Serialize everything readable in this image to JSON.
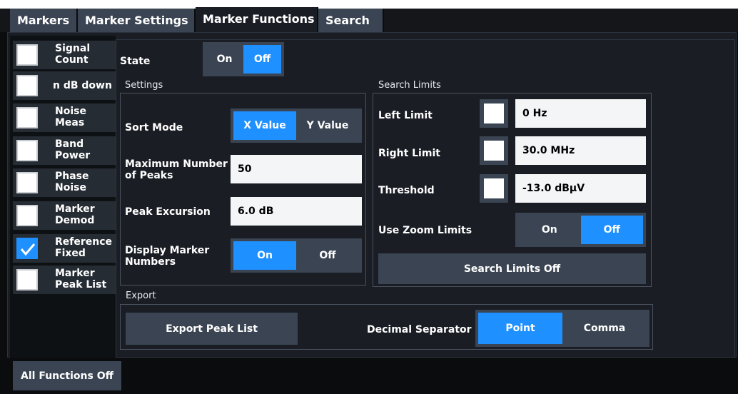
{
  "tabs": [
    {
      "label": "Markers",
      "active": false
    },
    {
      "label": "Marker Settings",
      "active": false
    },
    {
      "label": "Marker Functions",
      "active": true
    },
    {
      "label": "Search",
      "active": false
    }
  ],
  "sidebar": {
    "items": [
      {
        "label": "Signal Count",
        "checked": false
      },
      {
        "label": "n dB down",
        "checked": false
      },
      {
        "label": "Noise Meas",
        "checked": false
      },
      {
        "label": "Band Power",
        "checked": false
      },
      {
        "label": "Phase Noise",
        "checked": false
      },
      {
        "label": "Marker Demod",
        "checked": false
      },
      {
        "label": "Reference Fixed",
        "checked": true
      },
      {
        "label": "Marker Peak List",
        "checked": false
      }
    ],
    "all_off_label": "All Functions Off"
  },
  "state": {
    "label": "State",
    "options": [
      "On",
      "Off"
    ],
    "selected": "Off"
  },
  "settings": {
    "title": "Settings",
    "sort_mode_label": "Sort Mode",
    "sort_mode_options": [
      "X Value",
      "Y Value"
    ],
    "sort_mode_selected": "X Value",
    "max_peaks_label": "Maximum Number of Peaks",
    "max_peaks_value": "50",
    "peak_excursion_label": "Peak Excursion",
    "peak_excursion_value": "6.0 dB",
    "display_numbers_label": "Display Marker Numbers",
    "display_numbers_options": [
      "On",
      "Off"
    ],
    "display_numbers_selected": "On"
  },
  "search_limits": {
    "title": "Search Limits",
    "left_limit_label": "Left Limit",
    "left_limit_value": "0 Hz",
    "right_limit_label": "Right Limit",
    "right_limit_value": "30.0 MHz",
    "threshold_label": "Threshold",
    "threshold_value": "-13.0 dBµV",
    "zoom_limits_label": "Use Zoom Limits",
    "zoom_limits_options": [
      "On",
      "Off"
    ],
    "zoom_limits_selected": "Off",
    "search_limits_off_label": "Search Limits Off"
  },
  "export": {
    "title": "Export",
    "export_button_label": "Export Peak List",
    "decimal_separator_label": "Decimal Separator",
    "decimal_separator_options": [
      "Point",
      "Comma"
    ],
    "decimal_separator_selected": "Point"
  },
  "colors": {
    "accent": "#1e90ff",
    "background": "#0b0c0e",
    "panel": "#1a1e24",
    "control": "#3a4452"
  }
}
